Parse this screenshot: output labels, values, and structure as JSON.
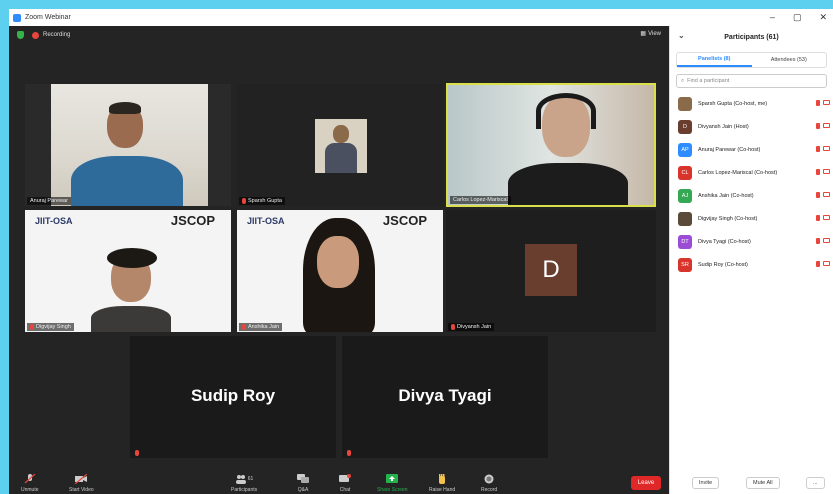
{
  "window": {
    "title": "Zoom Webinar",
    "controls": [
      "–",
      "▢",
      "✕"
    ]
  },
  "meeting": {
    "recording_label": "Recording",
    "view_label": "View",
    "tiles": [
      {
        "name": "Anuraj Parewar"
      },
      {
        "name": "Sparsh Gupta"
      },
      {
        "name": "Carlos Lopez-Mariscal"
      },
      {
        "name": "Digvijay Singh"
      },
      {
        "name": "Anshika Jain"
      },
      {
        "name": "Divyansh Jain",
        "avatar_letter": "D"
      },
      {
        "name": "Sudip Roy"
      },
      {
        "name": "Divya Tyagi"
      }
    ],
    "logos": {
      "org": "JIIT-OSA",
      "event": "JSCOP"
    }
  },
  "toolbar": {
    "unmute": "Unmute",
    "start_video": "Start Video",
    "participants": "Participants",
    "participants_count": "61",
    "qa": "Q&A",
    "chat": "Chat",
    "share_screen": "Share Screen",
    "raise_hand": "Raise Hand",
    "record": "Record",
    "leave": "Leave"
  },
  "panel": {
    "title": "Participants (61)",
    "tab_panelists": "Panelists (8)",
    "tab_attendees": "Attendees (53)",
    "search_placeholder": "Find a participant",
    "participants": [
      {
        "name": "Sparsh Gupta (Co-host, me)",
        "avatar": "",
        "color": "#8b6a4a"
      },
      {
        "name": "Divyansh Jain (Host)",
        "avatar": "D",
        "color": "#6a3e2e"
      },
      {
        "name": "Anuraj Parewar (Co-host)",
        "avatar": "AP",
        "color": "#2d8cff"
      },
      {
        "name": "Carlos Lopez-Mariscal (Co-host)",
        "avatar": "CL",
        "color": "#d9342b"
      },
      {
        "name": "Anshika Jain (Co-host)",
        "avatar": "AJ",
        "color": "#34a853"
      },
      {
        "name": "Digvijay Singh (Co-host)",
        "avatar": "",
        "color": "#5a4a3a"
      },
      {
        "name": "Divya Tyagi (Co-host)",
        "avatar": "DT",
        "color": "#9b4bd4"
      },
      {
        "name": "Sudip Roy (Co-host)",
        "avatar": "SR",
        "color": "#d9342b"
      }
    ],
    "invite": "Invite",
    "mute_all": "Mute All",
    "more": "..."
  }
}
